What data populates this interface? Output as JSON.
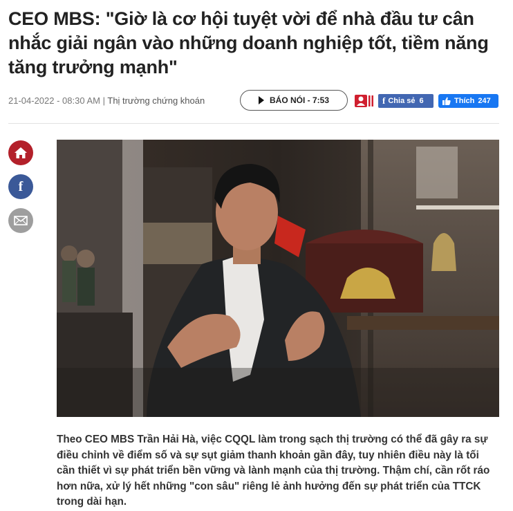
{
  "article": {
    "title": "CEO MBS: \"Giờ là cơ hội tuyệt vời để nhà đầu tư cân nhắc giải ngân vào những doanh nghiệp tốt, tiềm năng tăng trưởng mạnh\"",
    "date": "21-04-2022 - 08:30 AM",
    "separator": "|",
    "category": "Thị trường chứng khoán",
    "sapo": "Theo CEO MBS Trần Hải Hà, việc CQQL làm trong sạch thị trường có thể đã gây ra sự điều chỉnh về điểm số và sự sụt giảm thanh khoản gần đây, tuy nhiên điều này là tối cần thiết vì sự phát triển bền vững và lành mạnh của thị trường. Thậm chí, cần rốt ráo hơn nữa, xử lý hết những \"con sâu\" riêng lẻ ảnh hưởng đến sự phát triển của TTCK trong dài hạn."
  },
  "toolbar": {
    "audio_label": "BÁO NÓI - 7:53",
    "share_label": "Chia sẻ",
    "share_count": "6",
    "like_label": "Thích",
    "like_count": "247"
  },
  "social": {
    "icons": [
      "home-icon",
      "facebook-icon",
      "mail-icon"
    ],
    "colors": {
      "home": "#b3202a",
      "facebook": "#3b5998",
      "mail": "#9e9e9e"
    }
  },
  "colors": {
    "facebook_share": "#4267b2",
    "facebook_like": "#1877f2"
  }
}
